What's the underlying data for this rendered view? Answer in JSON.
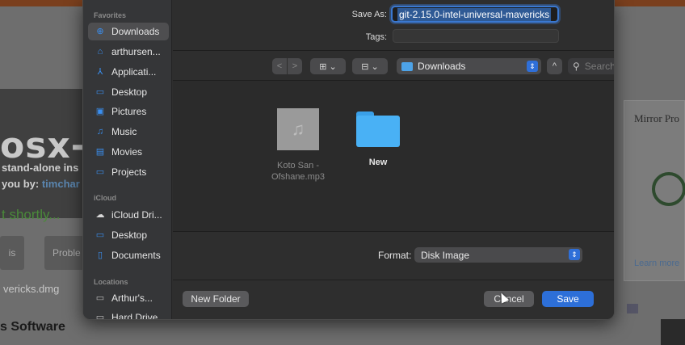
{
  "background": {
    "title": "osx-in",
    "line1": "stand-alone ins",
    "line2_prefix": "you by: ",
    "line2_link": "timchar",
    "green_text": "t shortly...",
    "btn_a": "is",
    "btn_b": "Proble",
    "dmg_text": "vericks.dmg",
    "software_text": "s Software",
    "card_title": "Mirror Pro",
    "card_link": "Learn more"
  },
  "sidebar": {
    "favorites_heading": "Favorites",
    "icloud_heading": "iCloud",
    "locations_heading": "Locations",
    "favorites": [
      {
        "label": "Downloads",
        "icon": "download-circle-icon",
        "selected": true
      },
      {
        "label": "arthursen...",
        "icon": "home-icon"
      },
      {
        "label": "Applicati...",
        "icon": "applications-icon"
      },
      {
        "label": "Desktop",
        "icon": "desktop-icon"
      },
      {
        "label": "Pictures",
        "icon": "pictures-icon"
      },
      {
        "label": "Music",
        "icon": "music-note-icon"
      },
      {
        "label": "Movies",
        "icon": "film-icon"
      },
      {
        "label": "Projects",
        "icon": "folder-icon"
      }
    ],
    "icloud": [
      {
        "label": "iCloud Dri...",
        "icon": "cloud-icon"
      },
      {
        "label": "Desktop",
        "icon": "desktop-icon"
      },
      {
        "label": "Documents",
        "icon": "document-icon"
      }
    ],
    "locations": [
      {
        "label": "Arthur's...",
        "icon": "laptop-icon"
      },
      {
        "label": "Hard Drive",
        "icon": "hard-drive-icon"
      }
    ]
  },
  "save_as": {
    "label": "Save As:",
    "value": "git-2.15.0-intel-universal-mavericks"
  },
  "tags": {
    "label": "Tags:"
  },
  "toolbar": {
    "back_glyph": "<",
    "forward_glyph": ">",
    "view_icons_glyph": "⊞ ⌄",
    "view_group_glyph": "⊟ ⌄",
    "location": "Downloads",
    "expand_glyph": "^",
    "search_placeholder": "Search"
  },
  "files": [
    {
      "name": "Koto San - Ofshane.mp3",
      "kind": "audio"
    },
    {
      "name": "New",
      "kind": "folder"
    }
  ],
  "format": {
    "label": "Format:",
    "value": "Disk Image"
  },
  "buttons": {
    "new_folder": "New Folder",
    "cancel": "Cancel",
    "save": "Save"
  }
}
